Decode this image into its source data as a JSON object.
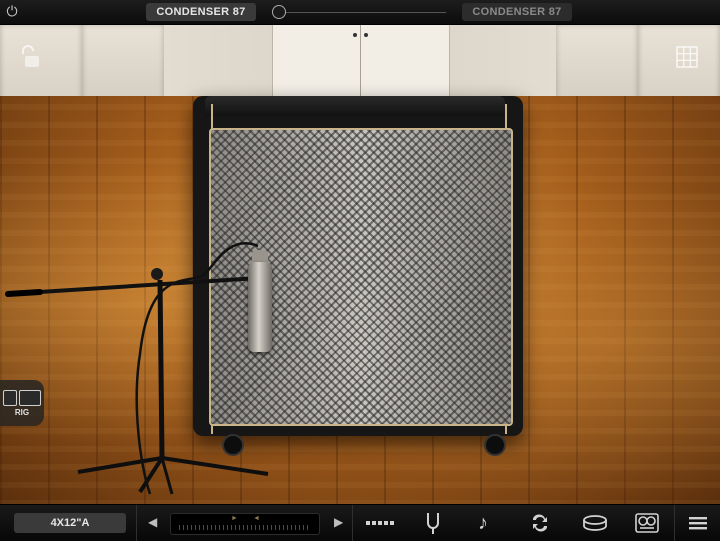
{
  "top_bar": {
    "mic_a_label": "CONDENSER 87",
    "mic_b_label": "CONDENSER 87"
  },
  "rig_tab": {
    "label": "RIG"
  },
  "bottom_bar": {
    "cabinet_name": "4X12\"A"
  },
  "icons": {
    "power": "power-icon",
    "lock": "unlock-icon",
    "grid": "grid-icon",
    "presets": "presets-icon",
    "tuner": "tuning-fork-icon",
    "tempo": "music-note-icon",
    "looper": "loop-icon",
    "drums": "drum-icon",
    "recorder": "tape-recorder-icon",
    "menu": "menu-icon"
  },
  "colors": {
    "bar": "#0c0c0c",
    "slot_active": "#3a3a3a",
    "slot_inactive": "#2c2c2c",
    "piping": "#c9b48a"
  }
}
